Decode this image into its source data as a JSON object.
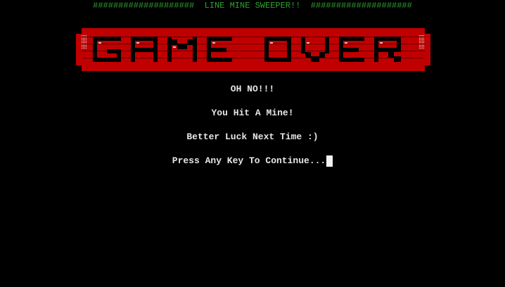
{
  "header": {
    "text": "####################  LINE MINE SWEEPER!!  ####################"
  },
  "banner": {
    "text": "GAME OVER",
    "color": "#c00000",
    "shade_color": "#e8e8e8"
  },
  "messages": {
    "line1": "OH NO!!!",
    "line2": "You Hit A Mine!",
    "line3": "Better Luck Next Time :)",
    "line4": "Press Any Key To Continue..."
  },
  "colors": {
    "background": "#000000",
    "header": "#2fa12f",
    "text": "#e6e6e6"
  }
}
